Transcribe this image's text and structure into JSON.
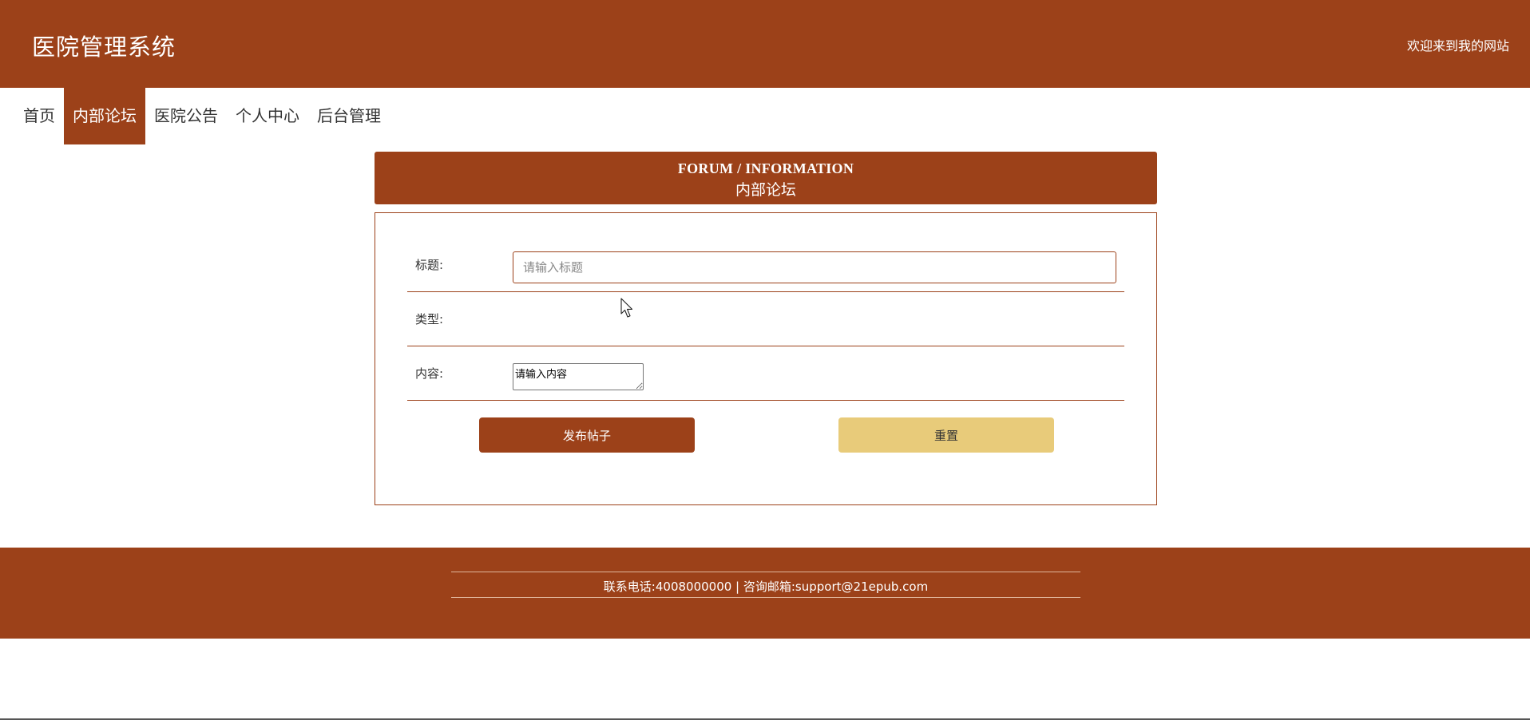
{
  "header": {
    "site_title": "医院管理系统",
    "welcome_text": "欢迎来到我的网站"
  },
  "nav": {
    "items": [
      {
        "label": "首页",
        "active": false
      },
      {
        "label": "内部论坛",
        "active": true
      },
      {
        "label": "医院公告",
        "active": false
      },
      {
        "label": "个人中心",
        "active": false
      },
      {
        "label": "后台管理",
        "active": false
      }
    ]
  },
  "banner": {
    "title_en": "FORUM / INFORMATION",
    "title_cn": "内部论坛"
  },
  "form": {
    "title_label": "标题:",
    "title_placeholder": "请输入标题",
    "title_value": "",
    "type_label": "类型:",
    "content_label": "内容:",
    "content_value": "请输入内容",
    "submit_label": "发布帖子",
    "reset_label": "重置"
  },
  "footer": {
    "contact_text": "联系电话:4008000000 | 咨询邮箱:support@21epub.com"
  },
  "colors": {
    "brand": "#9c4119",
    "reset_button": "#e8cb7a",
    "background": "#ffffff"
  },
  "icons": {
    "cursor": "mouse-pointer-icon"
  }
}
